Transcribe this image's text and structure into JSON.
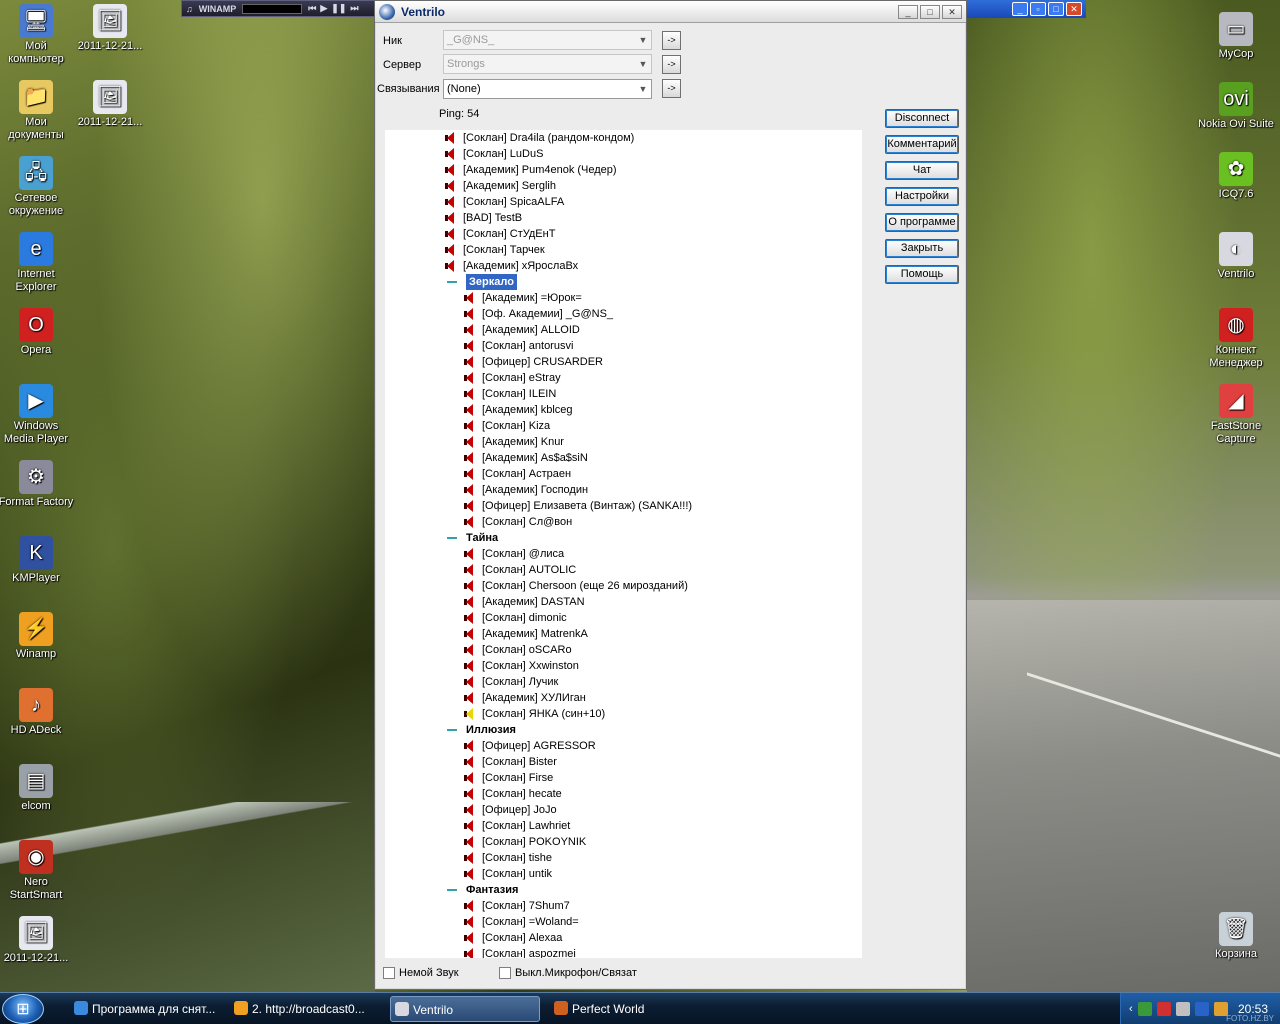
{
  "desktop": {
    "icons_left": [
      {
        "label": "Мой компьютер",
        "icon": "computer-icon"
      },
      {
        "label": "Мои документы",
        "icon": "documents-icon"
      },
      {
        "label": "Сетевое окружение",
        "icon": "network-icon"
      },
      {
        "label": "Internet Explorer",
        "icon": "ie-icon"
      },
      {
        "label": "Opera",
        "icon": "opera-icon"
      },
      {
        "label": "Windows Media Player",
        "icon": "wmp-icon"
      },
      {
        "label": "Format Factory",
        "icon": "format-factory-icon"
      },
      {
        "label": "KMPlayer",
        "icon": "kmplayer-icon"
      },
      {
        "label": "Winamp",
        "icon": "winamp-icon"
      },
      {
        "label": "HD ADeck",
        "icon": "hdadeck-icon"
      },
      {
        "label": "elcom",
        "icon": "elcom-icon"
      },
      {
        "label": "Nero StartSmart",
        "icon": "nero-icon"
      },
      {
        "label": "2011-12-21...",
        "icon": "image-file-icon"
      }
    ],
    "icons_second": [
      {
        "label": "2011-12-21...",
        "icon": "image-file-icon"
      },
      {
        "label": "2011-12-21...",
        "icon": "image-file-icon"
      }
    ],
    "icons_right": [
      {
        "label": "MyCop",
        "icon": "drive-icon"
      },
      {
        "label": "Nokia Ovi Suite",
        "icon": "ovi-icon"
      },
      {
        "label": "ICQ7.6",
        "icon": "icq-icon"
      },
      {
        "label": "Ventrilo",
        "icon": "ventrilo-icon"
      },
      {
        "label": "Коннект Менеджер",
        "icon": "connect-icon"
      },
      {
        "label": "FastStone Capture",
        "icon": "faststone-icon"
      },
      {
        "label": "Корзина",
        "icon": "recycle-bin-icon"
      }
    ]
  },
  "winamp": {
    "title": "WINAMP"
  },
  "ventrilo": {
    "title": "Ventrilo",
    "nick_label": "Ник",
    "nick_value": "_G@NS_",
    "server_label": "Сервер",
    "server_value": "Strongs",
    "bind_label": "Связывания",
    "bind_value": "(None)",
    "arrow_label": "->",
    "ping": "Ping: 54",
    "buttons": [
      "Disconnect",
      "Комментарий",
      "Чат",
      "Настройки",
      "О программе",
      "Закрыть",
      "Помощь"
    ],
    "mute_sound": "Немой Звук",
    "mute_mic": "Выкл.Микрофон/Связат",
    "top_users": [
      "[Соклан] Dra4ila (рандом-кондом)",
      "[Соклан] LuDuS",
      "[Академик] Pum4enok (Чедер)",
      "[Академик] Serglih",
      "[Соклан] SpicaALFA",
      "[BAD] TestB",
      "[Соклан] СтУдЕнТ",
      "[Соклан] Тарчек",
      "[Академик] хЯрослаВх"
    ],
    "channels": [
      {
        "name": "Зеркало",
        "selected": true,
        "users": [
          "[Академик] =Юрок=",
          "[Оф. Академии] _G@NS_",
          "[Академик] ALLOID",
          "[Соклан] antorusvi",
          "[Офицер] CRUSARDER",
          "[Соклан] eStray",
          "[Соклан] ILEIN",
          "[Академик] kblceg",
          "[Соклан] Kiza",
          "[Академик] Knur",
          "[Академик] As$a$siN",
          "[Соклан] Астраен",
          "[Академик] Господин",
          "[Офицер] Елизавета (Винтаж) (SANKA!!!)",
          "[Соклан] Сл@вон"
        ]
      },
      {
        "name": "Тайна",
        "selected": false,
        "users": [
          "[Соклан] @лиса",
          "[Соклан] AUTOLIC",
          "[Соклан] Chersoon (еще 26 мирозданий)",
          "[Академик] DASTAN",
          "[Соклан] dimonic",
          "[Академик] MatrenkA",
          "[Соклан] oSCARo",
          "[Соклан] Xxwinston",
          "[Соклан] Лучик",
          "[Академик] ХУЛИган",
          "[Соклан] ЯНКА (син+10)"
        ]
      },
      {
        "name": "Иллюзия",
        "selected": false,
        "users": [
          "[Офицер] AGRESSOR",
          "[Соклан] Bister",
          "[Соклан] Firse",
          "[Соклан] hecate",
          "[Офицер] JoJo",
          "[Соклан] Lawhriet",
          "[Соклан] POKOYNIK",
          "[Соклан] tishe",
          "[Соклан] untik"
        ]
      },
      {
        "name": "Фантазия",
        "selected": false,
        "users": [
          "[Соклан] 7Shum7",
          "[Соклан] =Woland=",
          "[Соклан] Alexaa",
          "[Соклан] aspozmei"
        ]
      }
    ],
    "talking_user": "[Соклан] ЯНКА (син+10)"
  },
  "taskbar": {
    "tasks": [
      {
        "label": "Программа для снят...",
        "icon": "ie-icon",
        "active": false
      },
      {
        "label": "2. http://broadcast0...",
        "icon": "winamp-icon",
        "active": false
      },
      {
        "label": "Ventrilo",
        "icon": "ventrilo-icon",
        "active": true
      },
      {
        "label": "Perfect World",
        "icon": "perfect-world-icon",
        "active": false
      }
    ],
    "clock": "20:53",
    "watermark": "FOTO.HZ.BY"
  }
}
